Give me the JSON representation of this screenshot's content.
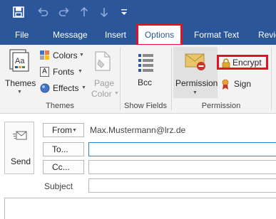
{
  "qat": {
    "icons": [
      "save-icon",
      "undo-icon",
      "redo-icon",
      "up-arrow-icon",
      "down-arrow-icon",
      "customize-icon"
    ]
  },
  "tabs": [
    {
      "label": "File"
    },
    {
      "label": "Message"
    },
    {
      "label": "Insert"
    },
    {
      "label": "Options",
      "active": true
    },
    {
      "label": "Format Text"
    },
    {
      "label": "Revie"
    }
  ],
  "ribbon": {
    "themes_group": {
      "themes_label": "Themes",
      "colors_label": "Colors",
      "fonts_label": "Fonts",
      "effects_label": "Effects",
      "page_color_line1": "Page",
      "page_color_line2": "Color",
      "group_label": "Themes"
    },
    "show_fields_group": {
      "bcc_label": "Bcc",
      "group_label": "Show Fields"
    },
    "permission_group": {
      "permission_label": "Permission",
      "encrypt_label": "Encrypt",
      "sign_label": "Sign",
      "group_label": "Permission"
    }
  },
  "compose": {
    "send_label": "Send",
    "from_label": "From",
    "from_value": "Max.Mustermann@lrz.de",
    "to_label": "To...",
    "cc_label": "Cc...",
    "subject_label": "Subject"
  },
  "colors": {
    "accent": "#2b579a",
    "highlight": "#e81123"
  }
}
